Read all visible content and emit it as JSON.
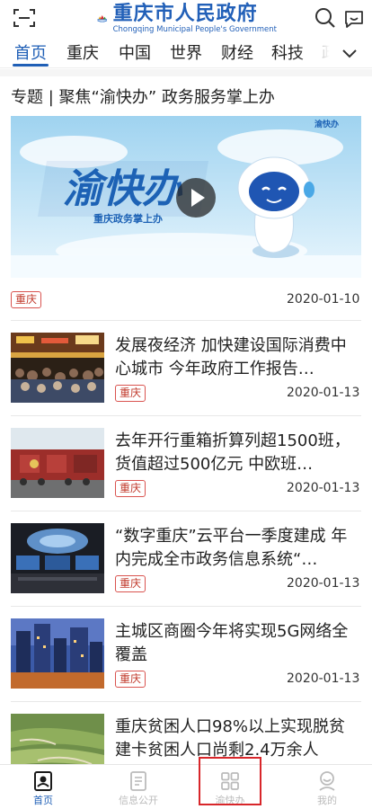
{
  "header": {
    "logo_cn": "重庆市人民政府",
    "logo_en": "Chongqing Municipal People's Government",
    "icons": [
      "scan-icon",
      "search-icon",
      "chat-icon"
    ]
  },
  "tabs": [
    {
      "label": "首页",
      "active": true
    },
    {
      "label": "重庆"
    },
    {
      "label": "中国"
    },
    {
      "label": "世界"
    },
    {
      "label": "财经"
    },
    {
      "label": "科技"
    },
    {
      "label": "政"
    }
  ],
  "featured": {
    "title": "专题 | 聚焦“渝快办” 政务服务掌上办",
    "hero_headline": "渝快办",
    "hero_subline": "重庆政务掌上办",
    "hero_badge": "渝快办",
    "tag": "重庆",
    "date": "2020-01-10"
  },
  "news": [
    {
      "title": "发展夜经济 加快建设国际消费中心城市 今年政府工作报告…",
      "tag": "重庆",
      "date": "2020-01-13"
    },
    {
      "title": "去年开行重箱折算列超1500班，货值超过500亿元 中欧班…",
      "tag": "重庆",
      "date": "2020-01-13"
    },
    {
      "title": "“数字重庆”云平台一季度建成 年内完成全市政务信息系统“…",
      "tag": "重庆",
      "date": "2020-01-13"
    },
    {
      "title": "主城区商圈今年将实现5G网络全覆盖",
      "tag": "重庆",
      "date": "2020-01-13"
    },
    {
      "title": "重庆贫困人口98%以上实现脱贫 建卡贫困人口尚剩2.4万余人",
      "tag": "",
      "date": ""
    }
  ],
  "bottom_nav": [
    {
      "label": "首页",
      "icon": "home-icon",
      "active": true
    },
    {
      "label": "信息公开",
      "icon": "document-icon"
    },
    {
      "label": "渝快办",
      "icon": "grid-icon"
    },
    {
      "label": "我的",
      "icon": "user-icon"
    }
  ],
  "colors": {
    "accent": "#1f5fb6",
    "tag_red": "#d9534f",
    "highlight_red": "#d8262a"
  }
}
